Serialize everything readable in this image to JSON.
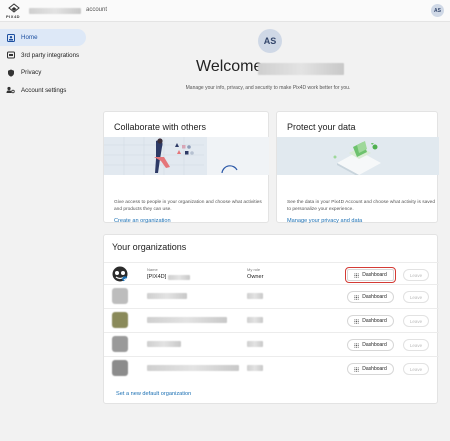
{
  "topbar": {
    "logo_text": "PIX4D",
    "account_label": "account",
    "avatar_initials": "AS"
  },
  "sidebar": {
    "items": [
      {
        "label": "Home",
        "active": true
      },
      {
        "label": "3rd party integrations",
        "active": false
      },
      {
        "label": "Privacy",
        "active": false
      },
      {
        "label": "Account settings",
        "active": false
      }
    ]
  },
  "header": {
    "avatar_initials": "AS",
    "welcome": "Welcome,",
    "subtitle": "Manage your info, privacy, and security to make Pix4D work better for you."
  },
  "collaborate": {
    "title": "Collaborate with others",
    "description": "Give access to people in your organization and choose what activities and products they can use.",
    "link": "Create an organization"
  },
  "protect": {
    "title": "Protect your data",
    "description": "See the data in your Pix4D Account and choose what activity is saved to personalize your experience.",
    "link": "Manage your privacy and data"
  },
  "organizations": {
    "title": "Your organizations",
    "name_label": "Name",
    "role_label": "My role",
    "first_name": "[PIX4D]",
    "first_role": "Owner",
    "dashboard_label": "Dashboard",
    "leave_label": "Leave",
    "set_default": "Set a new default organization"
  },
  "colors": {
    "accent": "#1a6fb3",
    "active_bg": "#dde8f7",
    "highlight": "#d43b35"
  }
}
